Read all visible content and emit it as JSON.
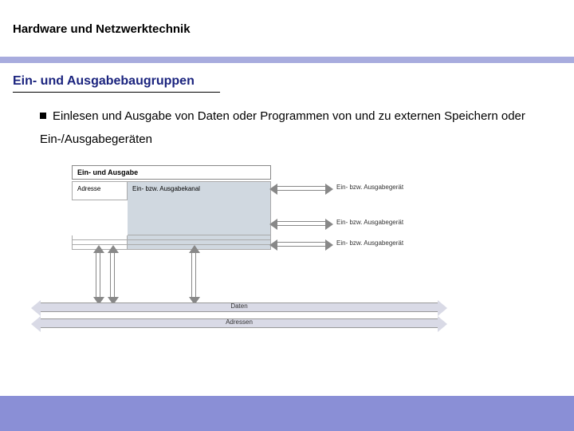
{
  "page": {
    "title": "Hardware und Netzwerktechnik",
    "section_title": "Ein- und Ausgabebaugruppen",
    "body": "Einlesen und Ausgabe von Daten oder Programmen von und zu externen Speichern oder Ein-/Ausgabegeräten"
  },
  "diagram": {
    "box_title": "Ein- und Ausgabe",
    "col1": "Adresse",
    "col2": "Ein- bzw. Ausgabekanal",
    "device1": "Ein- bzw. Ausgabegerät",
    "device2": "Ein- bzw. Ausgabegerät",
    "device3": "Ein- bzw. Ausgabegerät",
    "bus_daten": "Daten",
    "bus_adressen": "Adressen"
  }
}
